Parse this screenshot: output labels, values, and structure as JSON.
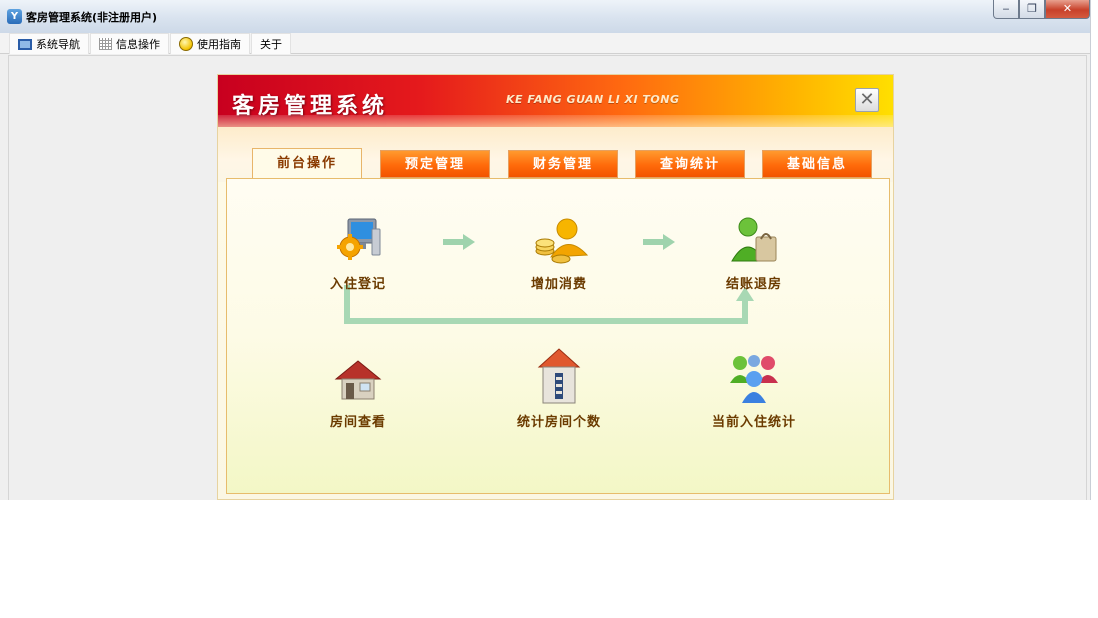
{
  "window": {
    "title": "客房管理系统(非注册用户)",
    "controls": {
      "minimize": "‒",
      "maximize": "❐",
      "close": "✕"
    }
  },
  "menu": {
    "items": [
      {
        "label": "系统导航",
        "icon": "monitor-icon"
      },
      {
        "label": "信息操作",
        "icon": "grid-icon"
      },
      {
        "label": "使用指南",
        "icon": "bulb-icon"
      },
      {
        "label": "关于",
        "icon": ""
      }
    ]
  },
  "panel": {
    "title": "客房管理系统",
    "subtitle": "KE FANG GUAN LI XI TONG",
    "close_label": "✕",
    "tabs": [
      {
        "label": "前台操作",
        "active": true
      },
      {
        "label": "预定管理",
        "active": false
      },
      {
        "label": "财务管理",
        "active": false
      },
      {
        "label": "查询统计",
        "active": false
      },
      {
        "label": "基础信息",
        "active": false
      }
    ],
    "features": [
      {
        "label": "入住登记",
        "icon": "computer-gear-icon"
      },
      {
        "label": "增加消费",
        "icon": "user-coins-icon"
      },
      {
        "label": "结账退房",
        "icon": "user-bag-icon"
      },
      {
        "label": "房间查看",
        "icon": "house-icon"
      },
      {
        "label": "统计房间个数",
        "icon": "building-icon"
      },
      {
        "label": "当前入住统计",
        "icon": "user-group-icon"
      }
    ]
  },
  "colors": {
    "banner_start": "#c8001f",
    "banner_end": "#ffe000",
    "tab_orange": "#ff6a0a",
    "flow_green": "#a8d8b4",
    "label_brown": "#6b3b00"
  }
}
